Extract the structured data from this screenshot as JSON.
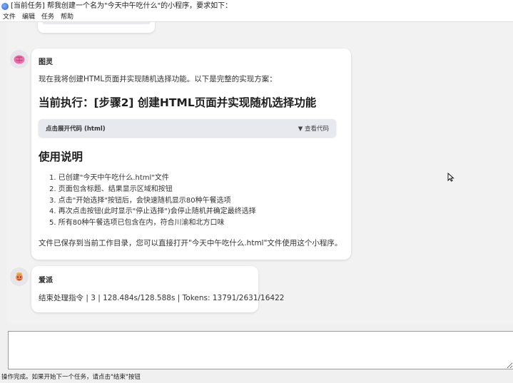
{
  "window": {
    "title": "[当前任务] 帮我创建一个名为\"今天中午吃什么\"的小程序，要求如下："
  },
  "menu": [
    "文件",
    "编辑",
    "任务",
    "帮助"
  ],
  "messages": {
    "assistant": {
      "sender": "图灵",
      "intro": "现在我将创建HTML页面并实现随机选择功能。以下是完整的实现方案：",
      "heading": "当前执行：[步骤2] 创建HTML页面并实现随机选择功能",
      "code_block": {
        "label": "点击展开代码 (html)",
        "toggle": "▼ 查看代码"
      },
      "usage_heading": "使用说明",
      "steps": [
        "1. 已创建\"今天中午吃什么.html\"文件",
        "2. 页面包含标题、结果显示区域和按钮",
        "3. 点击\"开始选择\"按钮后，会快速随机显示80种午餐选项",
        "4. 再次点击按钮(此时显示\"停止选择\")会停止随机并确定最终选择",
        "5. 所有80种午餐选项已包含在内，符合川渝和北方口味"
      ],
      "footer": "文件已保存到当前工作目录，您可以直接打开\"今天中午吃什么.html\"文件使用这个小程序。"
    },
    "system": {
      "sender": "爱派",
      "result": "结束处理指令 | 3 | 128.484s/128.588s | Tokens: 13791/2631/16422"
    }
  },
  "input": {
    "value": ""
  },
  "status": "操作完成。如果开始下一个任务，请点击\"结束\"按钮"
}
